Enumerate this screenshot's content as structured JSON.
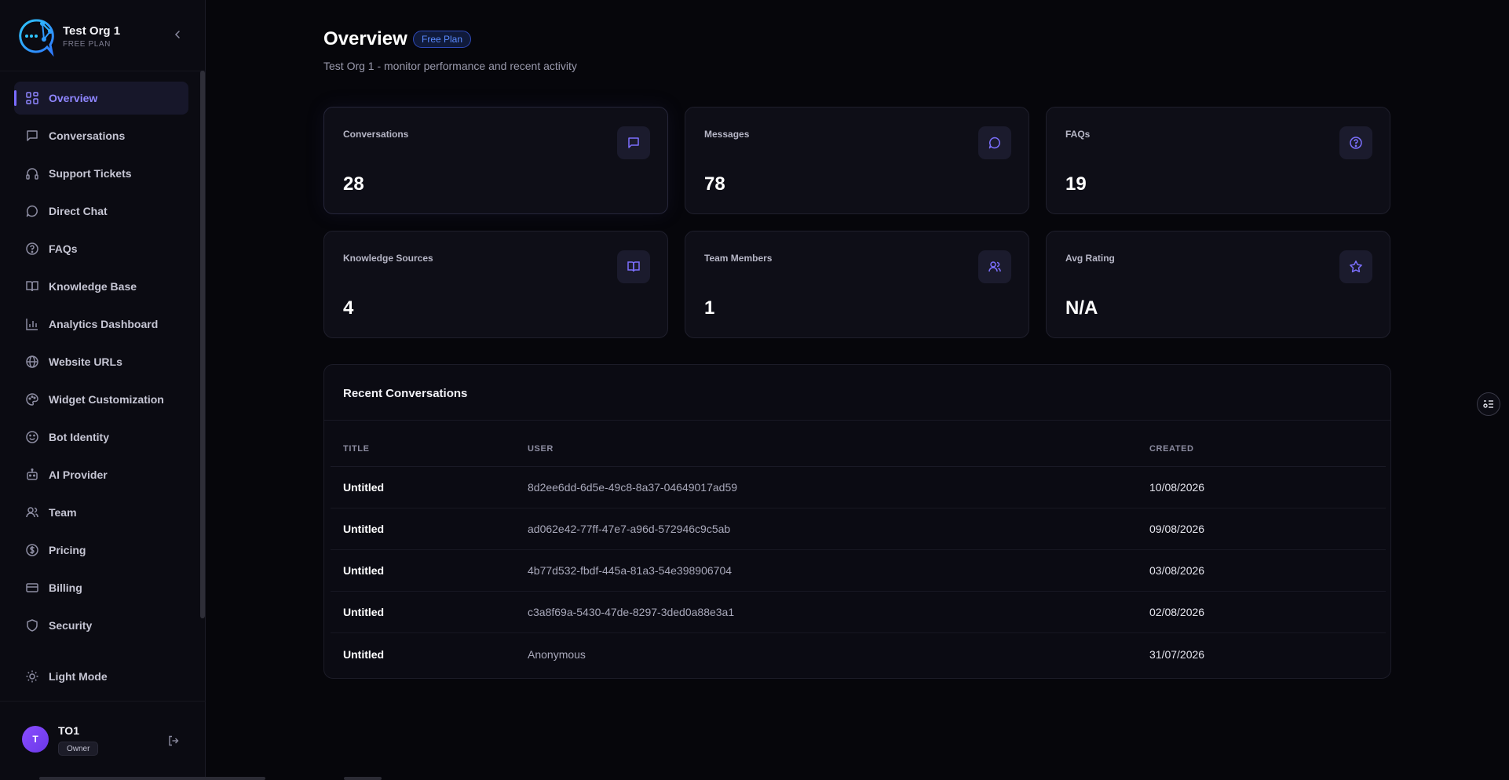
{
  "brand": {
    "org_name": "Test Org 1",
    "plan_label": "FREE PLAN",
    "logo_icon": "chat-bubble-network-logo",
    "collapse_icon": "chevron-left-icon"
  },
  "sidebar": {
    "items": [
      {
        "label": "Overview",
        "icon": "grid-icon",
        "active": true
      },
      {
        "label": "Conversations",
        "icon": "message-square-icon"
      },
      {
        "label": "Support Tickets",
        "icon": "headphones-icon"
      },
      {
        "label": "Direct Chat",
        "icon": "message-circle-icon"
      },
      {
        "label": "FAQs",
        "icon": "help-circle-icon"
      },
      {
        "label": "Knowledge Base",
        "icon": "book-open-icon"
      },
      {
        "label": "Analytics Dashboard",
        "icon": "bar-chart-icon"
      },
      {
        "label": "Website URLs",
        "icon": "globe-icon"
      },
      {
        "label": "Widget Customization",
        "icon": "palette-icon"
      },
      {
        "label": "Bot Identity",
        "icon": "smile-icon"
      },
      {
        "label": "AI Provider",
        "icon": "bot-icon"
      },
      {
        "label": "Team",
        "icon": "users-icon"
      },
      {
        "label": "Pricing",
        "icon": "dollar-circle-icon"
      },
      {
        "label": "Billing",
        "icon": "credit-card-icon"
      },
      {
        "label": "Security",
        "icon": "shield-icon"
      }
    ],
    "theme_toggle": {
      "label": "Light Mode",
      "icon": "sun-icon"
    }
  },
  "user": {
    "avatar_initial": "T",
    "name": "TO1",
    "role": "Owner",
    "logout_icon": "log-out-icon"
  },
  "header": {
    "title": "Overview",
    "plan_badge": "Free Plan",
    "subtitle": "Test Org 1 - monitor performance and recent activity"
  },
  "stats": [
    {
      "label": "Conversations",
      "value": "28",
      "icon": "message-square-icon"
    },
    {
      "label": "Messages",
      "value": "78",
      "icon": "message-circle-icon"
    },
    {
      "label": "FAQs",
      "value": "19",
      "icon": "help-circle-icon"
    },
    {
      "label": "Knowledge Sources",
      "value": "4",
      "icon": "book-open-icon"
    },
    {
      "label": "Team Members",
      "value": "1",
      "icon": "users-icon"
    },
    {
      "label": "Avg Rating",
      "value": "N/A",
      "icon": "star-icon"
    }
  ],
  "recent": {
    "title": "Recent Conversations",
    "columns": [
      "TITLE",
      "USER",
      "CREATED"
    ],
    "rows": [
      {
        "title": "Untitled",
        "user": "8d2ee6dd-6d5e-49c8-8a37-04649017ad59",
        "created": "10/08/2026"
      },
      {
        "title": "Untitled",
        "user": "ad062e42-77ff-47e7-a96d-572946c9c5ab",
        "created": "09/08/2026"
      },
      {
        "title": "Untitled",
        "user": "4b77d532-fbdf-445a-81a3-54e398906704",
        "created": "03/08/2026"
      },
      {
        "title": "Untitled",
        "user": "c3a8f69a-5430-47de-8297-3ded0a88e3a1",
        "created": "02/08/2026"
      },
      {
        "title": "Untitled",
        "user": "Anonymous",
        "created": "31/07/2026"
      }
    ]
  },
  "floating_button": {
    "icon": "settings-sliders-icon"
  },
  "colors": {
    "accent": "#7a6cff",
    "badge_blue": "#5b8bff",
    "avatar": "#8a4dff",
    "background": "#06060b"
  }
}
